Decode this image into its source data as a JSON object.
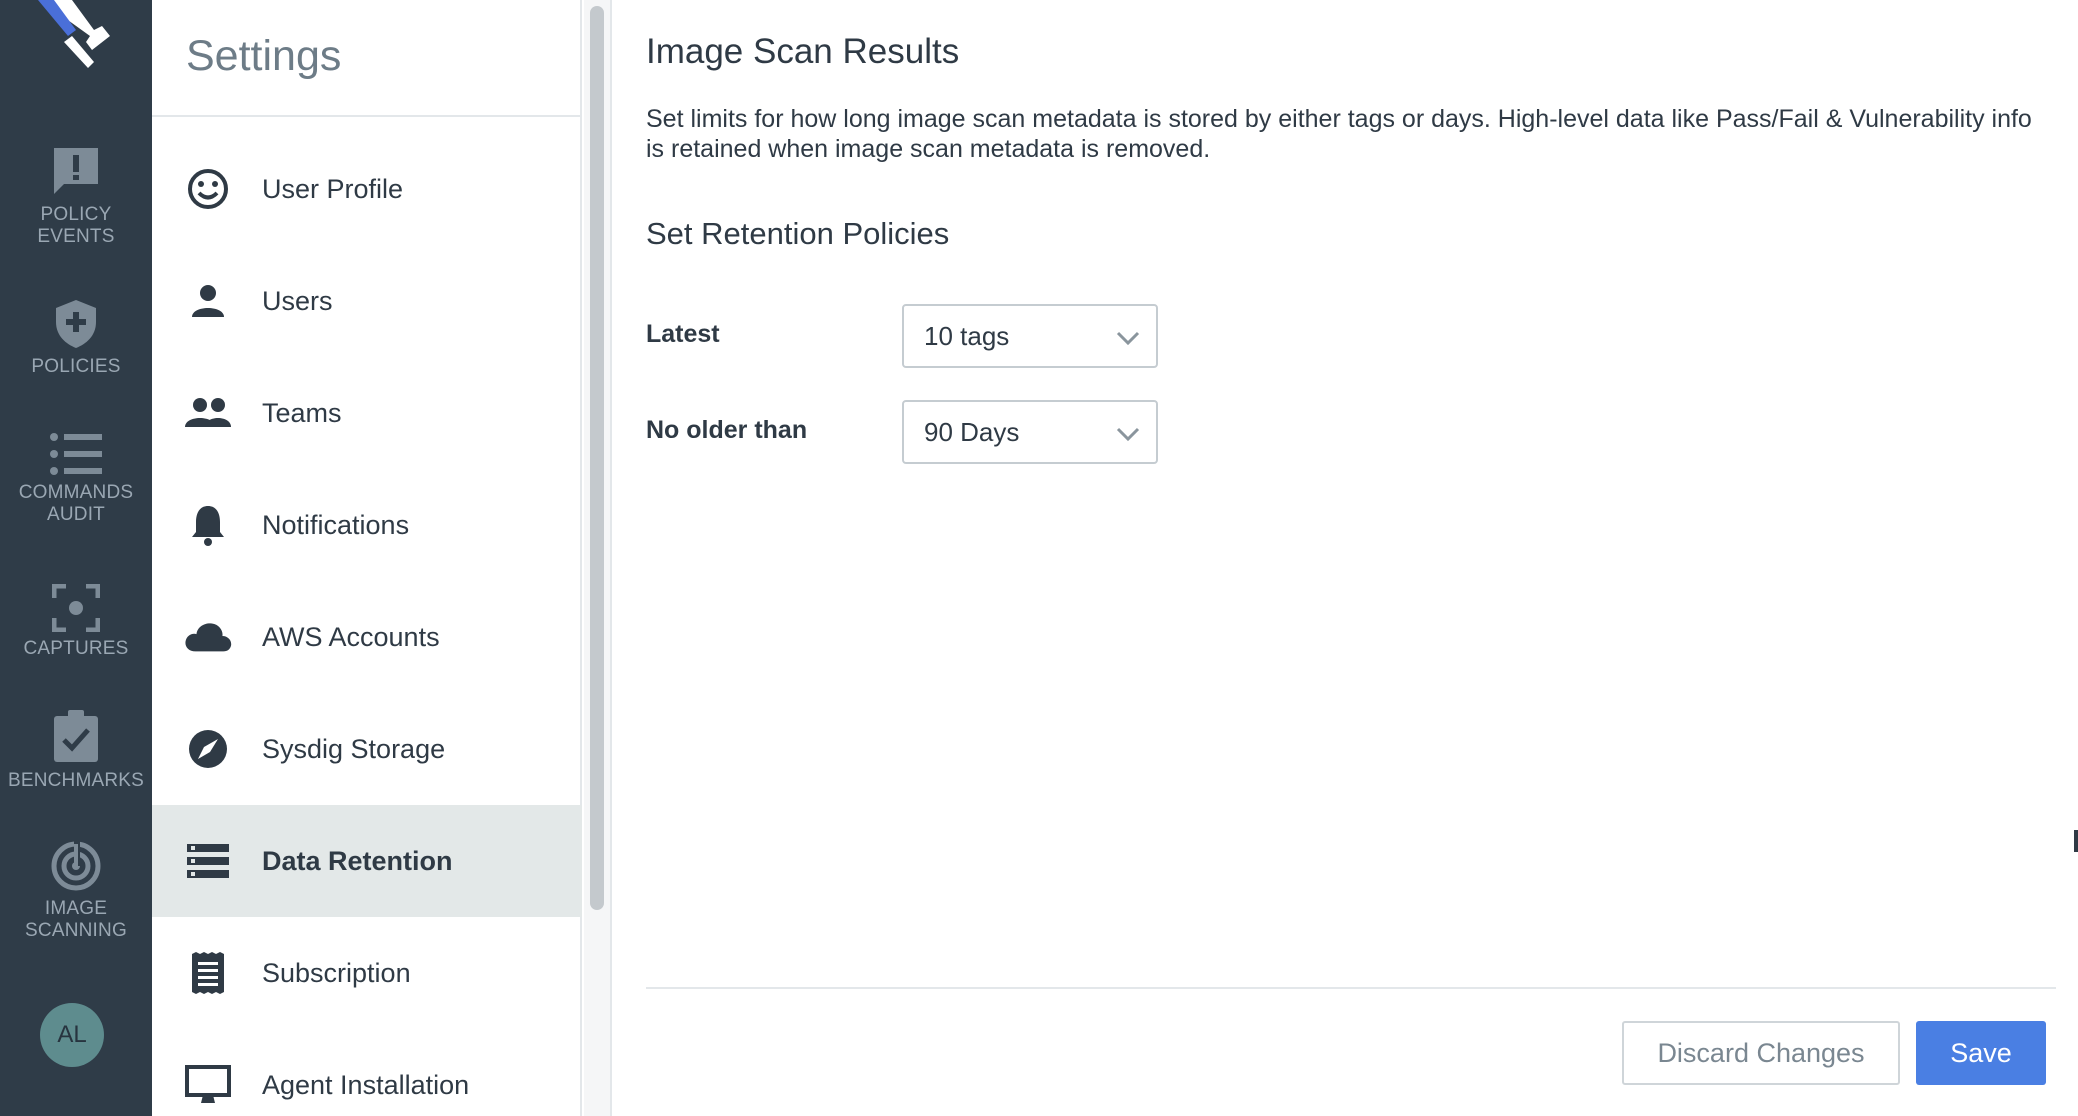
{
  "nav": {
    "items": [
      {
        "label": "POLICY\nEVENTS",
        "icon": "alert-message-icon"
      },
      {
        "label": "POLICIES",
        "icon": "shield-plus-icon"
      },
      {
        "label": "COMMANDS\nAUDIT",
        "icon": "list-icon"
      },
      {
        "label": "CAPTURES",
        "icon": "capture-focus-icon"
      },
      {
        "label": "BENCHMARKS",
        "icon": "clipboard-check-icon"
      },
      {
        "label": "IMAGE\nSCANNING",
        "icon": "scan-target-icon"
      }
    ],
    "avatar": "AL"
  },
  "settings_menu": {
    "title": "Settings",
    "items": [
      {
        "label": "User Profile",
        "icon": "smiley-icon"
      },
      {
        "label": "Users",
        "icon": "person-icon"
      },
      {
        "label": "Teams",
        "icon": "people-icon"
      },
      {
        "label": "Notifications",
        "icon": "bell-icon"
      },
      {
        "label": "AWS Accounts",
        "icon": "cloud-icon"
      },
      {
        "label": "Sysdig Storage",
        "icon": "storage-icon"
      },
      {
        "label": "Data Retention",
        "icon": "server-rows-icon",
        "active": true
      },
      {
        "label": "Subscription",
        "icon": "receipt-icon"
      },
      {
        "label": "Agent Installation",
        "icon": "monitor-icon"
      }
    ]
  },
  "main": {
    "title": "Image Scan Results",
    "description": "Set limits for how long image scan metadata is stored by either tags or days. High-level data like Pass/Fail & Vulnerability info is retained when image scan metadata is removed.",
    "section_title": "Set Retention Policies",
    "fields": [
      {
        "label": "Latest",
        "value": "10 tags"
      },
      {
        "label": "No older than",
        "value": "90 Days"
      }
    ],
    "discard_label": "Discard Changes",
    "save_label": "Save"
  },
  "colors": {
    "rail_bg": "#2f3c48",
    "accent": "#4a7fe3",
    "active_menu_bg": "#e3e8e8"
  }
}
